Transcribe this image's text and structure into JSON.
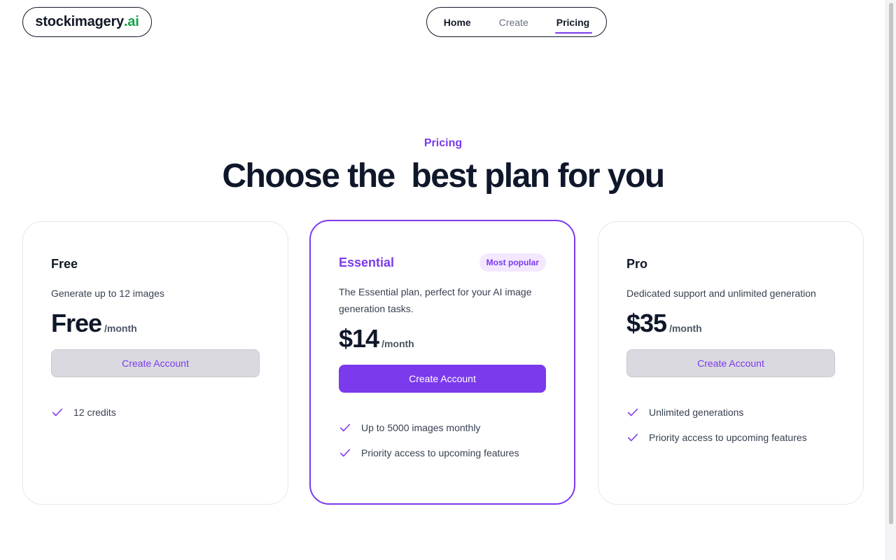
{
  "brand": {
    "name": "stockimagery",
    "tld": ".ai"
  },
  "nav": {
    "home": "Home",
    "create": "Create",
    "pricing": "Pricing"
  },
  "hero": {
    "eyebrow": "Pricing",
    "headline": "Choose the  best plan for you"
  },
  "colors": {
    "accent": "#7c3aed",
    "badge_bg": "#f3e8ff",
    "secondary_button": "#d9d9df"
  },
  "plans": [
    {
      "name": "Free",
      "description": "Generate up to 12 images",
      "price": "Free",
      "period": "/month",
      "cta": "Create Account",
      "features": [
        "12 credits"
      ]
    },
    {
      "name": "Essential",
      "badge": "Most popular",
      "description": "The Essential plan, perfect for your AI image generation tasks.",
      "price": "$14",
      "period": "/month",
      "cta": "Create Account",
      "features": [
        "Up to 5000 images monthly",
        "Priority access to upcoming features"
      ]
    },
    {
      "name": "Pro",
      "description": "Dedicated support and unlimited generation",
      "price": "$35",
      "period": "/month",
      "cta": "Create Account",
      "features": [
        "Unlimited generations",
        "Priority access to upcoming features"
      ]
    }
  ]
}
